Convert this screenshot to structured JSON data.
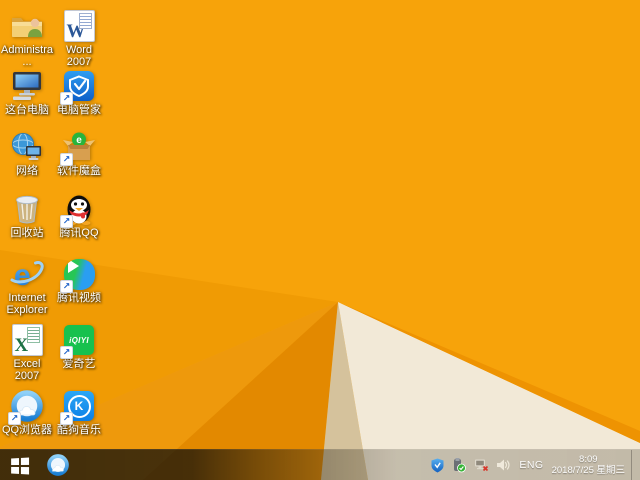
{
  "wallpaper": {
    "base_color": "#f7a30a",
    "facet_colors": {
      "wedge_left": "#f09b04",
      "wedge_left_lower": "#ee990c",
      "wedge_deep": "#e38900",
      "sliver_tan": "#d5c29c",
      "face_cream": "#f2e9d7",
      "ridge_stripe": "#ee9302"
    }
  },
  "desktop": {
    "icons": [
      {
        "label": "Administra..."
      },
      {
        "label": "Word 2007"
      },
      {
        "label": "这台电脑"
      },
      {
        "label": "电脑管家"
      },
      {
        "label": "网络"
      },
      {
        "label": "软件魔盒"
      },
      {
        "label": "回收站"
      },
      {
        "label": "腾讯QQ"
      },
      {
        "label": "Internet Explorer"
      },
      {
        "label": "腾讯视频"
      },
      {
        "label": "Excel 2007"
      },
      {
        "label": "爱奇艺"
      },
      {
        "label": "QQ浏览器"
      },
      {
        "label": "酷狗音乐"
      }
    ]
  },
  "glyphs": {
    "shortcut_arrow": "↗",
    "word_letter": "W",
    "excel_letter": "X",
    "ie_letter": "e",
    "iqiyi_text": "iQIYI",
    "kugou_letter": "K",
    "softbox_letter": "e"
  },
  "taskbar": {
    "pinned": [
      "qq-browser"
    ],
    "tray_icon_names": [
      "pc-manager-shield",
      "usb-ok",
      "network-disconnected",
      "volume"
    ],
    "tray": {
      "language": "ENG",
      "time": "8:09",
      "date": "2018/7/25 星期三"
    }
  }
}
